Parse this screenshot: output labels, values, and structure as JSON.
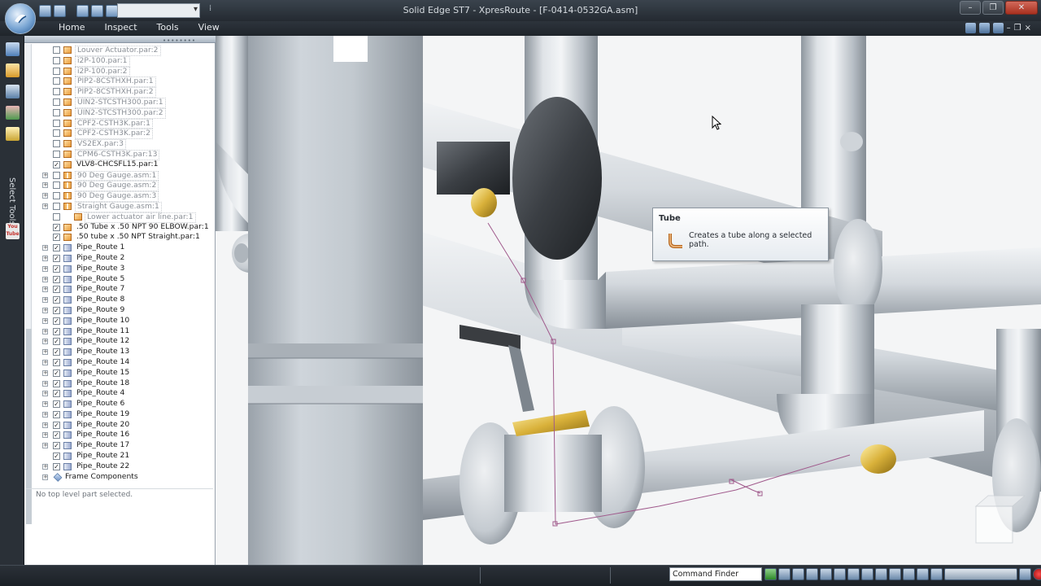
{
  "window": {
    "title": "Solid Edge ST7 - XpresRoute - [F-0414-0532GA.asm]",
    "controls": [
      "–",
      "❐",
      "✕"
    ]
  },
  "ribbon": {
    "tabs": [
      "Home",
      "Inspect",
      "Tools",
      "View"
    ],
    "right_controls": [
      "?",
      "–",
      "❐",
      "×"
    ]
  },
  "left_strip": {
    "panel_label": "Select Tools",
    "youtube_badge": "You Tube"
  },
  "pathfinder": {
    "status": "No top level part selected.",
    "items": [
      {
        "label": "Louver Actuator.par:2",
        "type": "part",
        "checked": false,
        "expandable": false,
        "active": false
      },
      {
        "label": "i2P-100.par:1",
        "type": "part",
        "checked": false,
        "expandable": false,
        "active": false
      },
      {
        "label": "i2P-100.par:2",
        "type": "part",
        "checked": false,
        "expandable": false,
        "active": false
      },
      {
        "label": "PIP2-8CSTHXH.par:1",
        "type": "part",
        "checked": false,
        "expandable": false,
        "active": false
      },
      {
        "label": "PIP2-8CSTHXH.par:2",
        "type": "part",
        "checked": false,
        "expandable": false,
        "active": false
      },
      {
        "label": "UIN2-STCSTH300.par:1",
        "type": "part",
        "checked": false,
        "expandable": false,
        "active": false
      },
      {
        "label": "UIN2-STCSTH300.par:2",
        "type": "part",
        "checked": false,
        "expandable": false,
        "active": false
      },
      {
        "label": "CPF2-CSTH3K.par:1",
        "type": "part",
        "checked": false,
        "expandable": false,
        "active": false
      },
      {
        "label": "CPF2-CSTH3K.par:2",
        "type": "part",
        "checked": false,
        "expandable": false,
        "active": false
      },
      {
        "label": "VS2EX.par:3",
        "type": "part",
        "checked": false,
        "expandable": false,
        "active": false
      },
      {
        "label": "CPM6-CSTH3K.par:13",
        "type": "part",
        "checked": false,
        "expandable": false,
        "active": false
      },
      {
        "label": "VLV8-CHCSFL15.par:1",
        "type": "part",
        "checked": true,
        "expandable": false,
        "active": true
      },
      {
        "label": "90 Deg Gauge.asm:1",
        "type": "asm",
        "checked": false,
        "expandable": true,
        "active": false
      },
      {
        "label": "90 Deg Gauge.asm:2",
        "type": "asm",
        "checked": false,
        "expandable": true,
        "active": false
      },
      {
        "label": "90 Deg Gauge.asm:3",
        "type": "asm",
        "checked": false,
        "expandable": true,
        "active": false
      },
      {
        "label": "Straight Gauge.asm:1",
        "type": "asm",
        "checked": false,
        "expandable": true,
        "active": false
      },
      {
        "label": "Lower actuator air line.par:1",
        "type": "part",
        "checked": false,
        "expandable": false,
        "active": false,
        "level": 2
      },
      {
        "label": ".50 Tube x .50 NPT 90 ELBOW.par:1",
        "type": "part",
        "checked": true,
        "expandable": false,
        "active": true
      },
      {
        "label": ".50 tube x .50 NPT Straight.par:1",
        "type": "part",
        "checked": true,
        "expandable": false,
        "active": true
      },
      {
        "label": "Pipe_Route 1",
        "type": "route",
        "checked": true,
        "expandable": true,
        "active": true
      },
      {
        "label": "Pipe_Route 2",
        "type": "route",
        "checked": true,
        "expandable": true,
        "active": true
      },
      {
        "label": "Pipe_Route 3",
        "type": "route",
        "checked": true,
        "expandable": true,
        "active": true
      },
      {
        "label": "Pipe_Route 5",
        "type": "route",
        "checked": true,
        "expandable": true,
        "active": true
      },
      {
        "label": "Pipe_Route 7",
        "type": "route",
        "checked": true,
        "expandable": true,
        "active": true
      },
      {
        "label": "Pipe_Route 8",
        "type": "route",
        "checked": true,
        "expandable": true,
        "active": true
      },
      {
        "label": "Pipe_Route 9",
        "type": "route",
        "checked": true,
        "expandable": true,
        "active": true
      },
      {
        "label": "Pipe_Route 10",
        "type": "route",
        "checked": true,
        "expandable": true,
        "active": true
      },
      {
        "label": "Pipe_Route 11",
        "type": "route",
        "checked": true,
        "expandable": true,
        "active": true
      },
      {
        "label": "Pipe_Route 12",
        "type": "route",
        "checked": true,
        "expandable": true,
        "active": true
      },
      {
        "label": "Pipe_Route 13",
        "type": "route",
        "checked": true,
        "expandable": true,
        "active": true
      },
      {
        "label": "Pipe_Route 14",
        "type": "route",
        "checked": true,
        "expandable": true,
        "active": true
      },
      {
        "label": "Pipe_Route 15",
        "type": "route",
        "checked": true,
        "expandable": true,
        "active": true
      },
      {
        "label": "Pipe_Route 18",
        "type": "route",
        "checked": true,
        "expandable": true,
        "active": true
      },
      {
        "label": "Pipe_Route 4",
        "type": "route",
        "checked": true,
        "expandable": true,
        "active": true
      },
      {
        "label": "Pipe_Route 6",
        "type": "route",
        "checked": true,
        "expandable": true,
        "active": true
      },
      {
        "label": "Pipe_Route 19",
        "type": "route",
        "checked": true,
        "expandable": true,
        "active": true
      },
      {
        "label": "Pipe_Route 20",
        "type": "route",
        "checked": true,
        "expandable": true,
        "active": true
      },
      {
        "label": "Pipe_Route 16",
        "type": "route",
        "checked": true,
        "expandable": true,
        "active": true
      },
      {
        "label": "Pipe_Route 17",
        "type": "route",
        "checked": true,
        "expandable": true,
        "active": true
      },
      {
        "label": "Pipe_Route 21",
        "type": "route",
        "checked": true,
        "expandable": false,
        "active": true
      },
      {
        "label": "Pipe_Route 22",
        "type": "route",
        "checked": true,
        "expandable": true,
        "active": true
      },
      {
        "label": "Frame Components",
        "type": "frame",
        "checked": false,
        "expandable": true,
        "active": true,
        "no_checkbox": true
      }
    ]
  },
  "tooltip": {
    "title": "Tube",
    "description": "Creates a tube along a selected path.",
    "icon": "tube-elbow-icon"
  },
  "statusbar": {
    "command_finder": "Command Finder"
  },
  "colors": {
    "pipe_light": "#e9ecef",
    "pipe_mid": "#b9c0c7",
    "pipe_dark": "#7d868f",
    "brass": "#d9b13a",
    "valve_body": "#3b3f44",
    "route_sketch": "#a05a8c"
  }
}
